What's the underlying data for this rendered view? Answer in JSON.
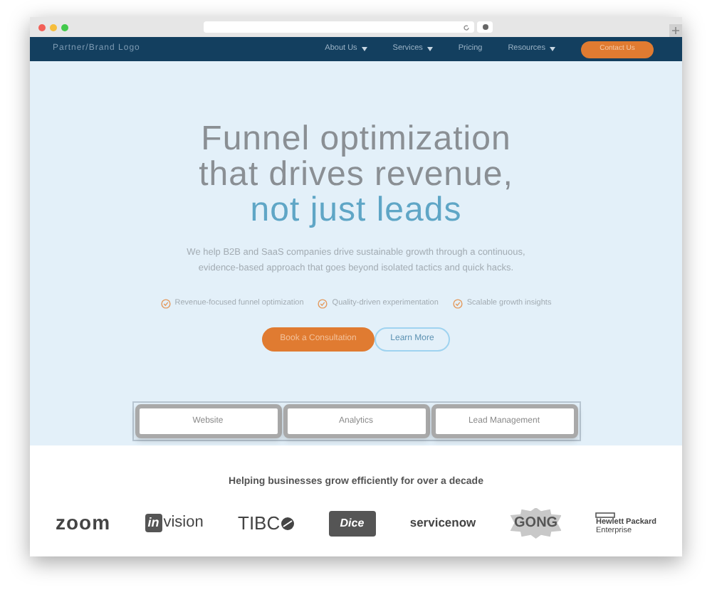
{
  "nav": {
    "logo": "Partner/Brand Logo",
    "items": [
      {
        "label": "About Us",
        "dropdown": true
      },
      {
        "label": "Services",
        "dropdown": true
      },
      {
        "label": "Pricing",
        "dropdown": false
      },
      {
        "label": "Resources",
        "dropdown": true
      }
    ],
    "cta": "Contact Us"
  },
  "hero": {
    "title_lines": [
      "Funnel optimization",
      "that drives revenue,"
    ],
    "title_accent": "not just leads",
    "subtitle_lines": [
      "We help B2B and SaaS companies drive sustainable growth through a continuous,",
      "evidence-based approach that goes beyond isolated tactics and quick hacks."
    ],
    "features": [
      "Revenue-focused funnel optimization",
      "Quality-driven experimentation",
      "Scalable growth insights"
    ],
    "buttons": [
      {
        "label": "Book a Consultation",
        "kind": "primary"
      },
      {
        "label": "Learn More",
        "kind": "outline"
      }
    ],
    "tabs": [
      "Website",
      "Analytics",
      "Lead Management"
    ]
  },
  "clients": {
    "heading": "Helping businesses grow efficiently for over a decade",
    "logos": [
      {
        "kind": "zoom",
        "text": "zoom"
      },
      {
        "kind": "invision",
        "badge": "in",
        "text": "vision"
      },
      {
        "kind": "tibco",
        "text": "TIBC"
      },
      {
        "kind": "dice",
        "text": "Dice"
      },
      {
        "kind": "servicenow",
        "text": "servicenow"
      },
      {
        "kind": "gong",
        "text": "GONG"
      },
      {
        "kind": "hpe",
        "lines": [
          "Hewlett Packard",
          "Enterprise"
        ]
      }
    ]
  }
}
